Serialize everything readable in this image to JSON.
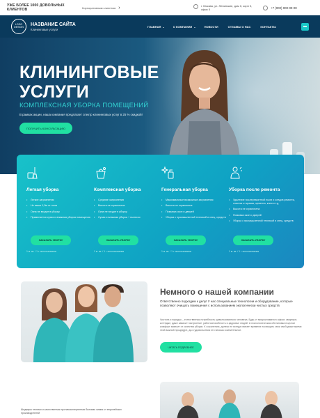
{
  "topbar": {
    "promo": "УЖЕ БОЛЕЕ 1000 ДОВОЛЬНЫХ КЛИЕНТОВ",
    "clients_link": "Корпоративным клиентам",
    "address_line1": "г. Москва, ул. Ленинские, дом 0, корп 0,",
    "address_line2": "офис 0",
    "phone": "+7 (000) 000-00-00"
  },
  "header": {
    "logo_line1": "LOGO",
    "logo_line2": "DESIGN",
    "site_name": "НАЗВАНИЕ САЙТА",
    "site_sub": "Клининговые услуги",
    "nav": [
      "ГЛАВНАЯ",
      "О КОМПАНИИ",
      "НОВОСТИ",
      "ОТЗЫВЫ О НАС",
      "КОНТАКТЫ"
    ]
  },
  "hero": {
    "title_line1": "КЛИНИНГОВЫЕ",
    "title_line2": "УСЛУГИ",
    "lead": "КОМПЛЕКСНАЯ УБОРКА ПОМЕЩЕНИЙ",
    "promo_text": "В рамках акции,  наша компания предлагает спектр клининговых услуг в 25 % скидкой!",
    "cta": "ПОЛУЧИТЬ КОНСУЛЬТАЦИЮ"
  },
  "services": [
    {
      "title": "Легкая уборка",
      "items": [
        "Легкие загрязнения",
        "Не выше 1,5м от пола",
        "Окна не входят в уборку",
        "Применяется сухая и влажная уборка помещения"
      ],
      "button": "ЗАКАЗАТЬ УБОРКУ",
      "price": "1 м. кв. / 1 г. использования"
    },
    {
      "title": "Комплексная уборка",
      "items": [
        "Средние загрязнения",
        "Высота не ограничена",
        "Окна не входят в уборку",
        "Сухая и влажная уборка + пылесос"
      ],
      "button": "ЗАКАЗАТЬ УБОРКУ",
      "price": "1 м. кв. / 1 г. использования"
    },
    {
      "title": "Генеральная уборка",
      "items": [
        "Максимальные возможные загрязнения",
        "Высота не ограничена",
        "Помывка окон и дверей",
        "Уборка с промышленной техникой и спец. средств"
      ],
      "button": "ЗАКАЗАТЬ УБОРКУ",
      "price": "1 м. кв. / 1 г. использования"
    },
    {
      "title": "Уборка после ремонта",
      "items": [
        "Удаление послеремонтной пыли и следов ремонта, очистка от краски, цемента, клея и т.д.",
        "Высота не ограничена",
        "Помывка окон и дверей",
        "Уборка с промышленной техникой и спец. средств"
      ],
      "button": "ЗАКАЗАТЬ УБОРКУ",
      "price": "1 м. кв. / 1 г. использования"
    }
  ],
  "about": {
    "heading": "Немного о нашей компании",
    "question": "Ответственно подходим к делу! У нас специальные технологии и оборудование, которые позволяют очищать помещения с использованием экологически чистых средств",
    "text": "Чистота и порядок – естественная потребность цивилизованного человека. Будь от микроклимата в офисе, квартире, коттедже, даже зависит настроение, работоспособность и здоровье людей. А психологическая обстановка в целом комфорт зависит от качества уборки. К сожалению, далеко не всегда хватает времени посвящать свои свободные время этой важной процедуре, да и удовольствия это весьма сомнительное.",
    "cta": "ЧИТАТЬ ПОДРОБНЕЕ"
  },
  "bottom": {
    "text": "Шедевры техники и качественная противоаллергенная бытовая химия от европейских производителей"
  },
  "colors": {
    "header": "#0a3a5c",
    "accent_green": "#21e0a2",
    "accent_teal": "#18c2c9"
  }
}
